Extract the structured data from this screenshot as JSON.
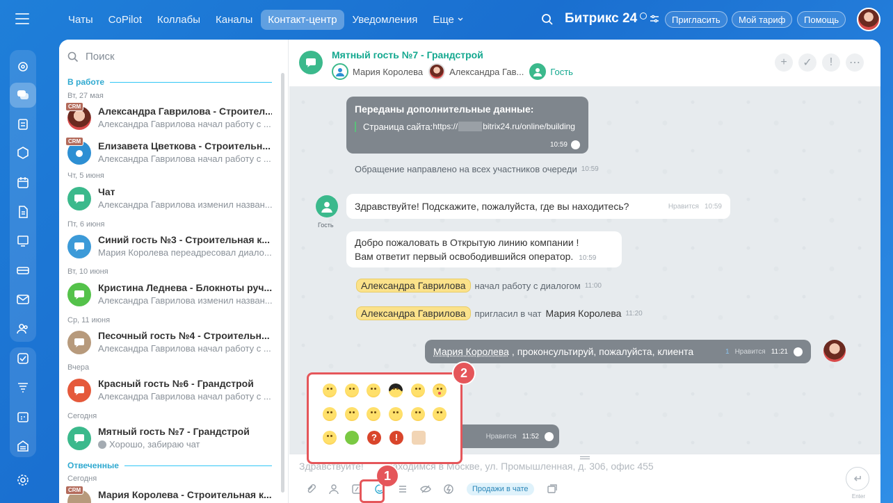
{
  "nav": {
    "tabs": [
      "Чаты",
      "CoPilot",
      "Коллабы",
      "Каналы",
      "Контакт-центр",
      "Уведомления"
    ],
    "active_tab": "Контакт-центр",
    "more": "Еще",
    "brand": "Битрикс 24",
    "invite": "Пригласить",
    "tariff": "Мой тариф",
    "help": "Помощь"
  },
  "list": {
    "search_placeholder": "Поиск",
    "section_work": "В работе",
    "section_answered": "Отвеченные",
    "dates": [
      "Вт, 27 мая",
      "Чт, 5 июня",
      "Пт, 6 июня",
      "Вт, 10 июня",
      "Ср, 11 июня",
      "Вчера",
      "Сегодня",
      "Сегодня"
    ],
    "items": [
      {
        "title": "Александра Гаврилова - Строител...",
        "sub": "Александра Гаврилова начал работу с ...",
        "crm": "CRM"
      },
      {
        "title": "Елизавета Цветкова - Строительн...",
        "sub": "Александра Гаврилова начал работу с ...",
        "crm": "CRM"
      },
      {
        "title": "Чат",
        "sub": "Александра Гаврилова изменил назван..."
      },
      {
        "title": "Синий гость №3 - Строительная к...",
        "sub": "Мария Королева переадресовал диало..."
      },
      {
        "title": "Кристина Леднева - Блокноты руч...",
        "sub": "Александра Гаврилова изменил назван..."
      },
      {
        "title": "Песочный гость №4 - Строительн...",
        "sub": "Александра Гаврилова начал работу с ..."
      },
      {
        "title": "Красный гость №6 - Грандстрой",
        "sub": "Александра Гаврилова начал работу с ..."
      },
      {
        "title": "Мятный гость №7 - Грандстрой",
        "sub": "Хорошо, забираю чат"
      },
      {
        "title": "Мария Королева - Строительная к...",
        "crm": "CRM"
      }
    ]
  },
  "chat": {
    "title": "Мятный гость №7 - Грандстрой",
    "members": [
      "Мария Королева",
      "Александра Гав...",
      "Гость"
    ],
    "data_msg": {
      "title": "Переданы дополнительные данные:",
      "label": "Страница сайта:",
      "url_a": "https://",
      "url_b": "bitrix24.ru/online/building",
      "time": "10:59"
    },
    "sys1": {
      "text": "Обращение направлено на всех участников очереди",
      "time": "10:59"
    },
    "guest_label": "Гость",
    "msg1": {
      "text": "Здравствуйте! Подскажите, пожалуйста, где вы находитесь?",
      "like": "Нравится",
      "time": "10:59"
    },
    "msg2": {
      "line1": "Добро пожаловать в Открытую линию компании !",
      "line2": "Вам ответит первый освободившийся оператор.",
      "time": "10:59"
    },
    "sys2": {
      "who": "Александра Гаврилова",
      "text": "начал работу с диалогом",
      "time": "11:00"
    },
    "sys3": {
      "who": "Александра Гаврилова",
      "text": "пригласил в чат",
      "target": "Мария Королева",
      "time": "11:20"
    },
    "msg3": {
      "who": "Мария Королева",
      "text": ", проконсультируй, пожалуйста, клиента",
      "count": "1",
      "like": "Нравится",
      "time": "11:21"
    },
    "msg4": {
      "like": "Нравится",
      "time": "11:52"
    },
    "input": {
      "placeholder_a": "Здравствуйте!",
      "placeholder_b": "находимся в Москве, ул. Промышленная, д. 306, офис 455",
      "sales": "Продажи в чате",
      "send_hint": "Enter"
    }
  },
  "badges": {
    "one": "1",
    "two": "2"
  },
  "colors": {
    "accent": "#e5565a",
    "mint": "#3bb98c",
    "chip": "#fbe28a"
  }
}
